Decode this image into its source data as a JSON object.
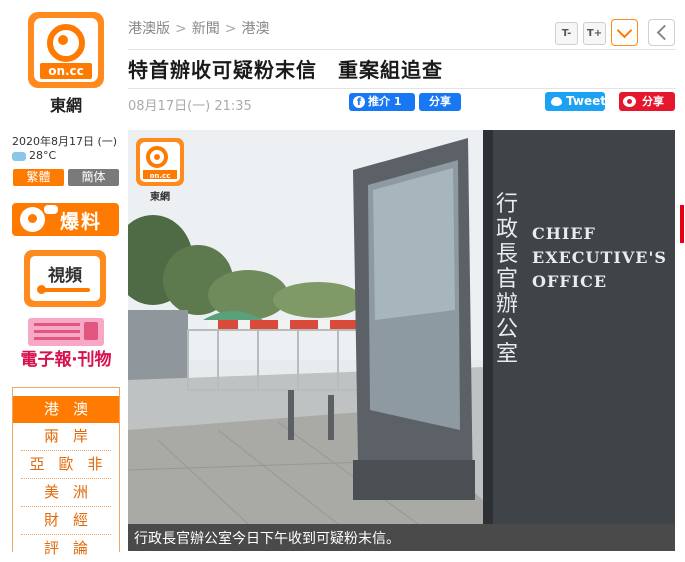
{
  "brand": {
    "logo_text": "on.cc",
    "name": "東網"
  },
  "sidebar": {
    "date": "2020年8月17日 (一)",
    "temperature": "28°C",
    "lang_traditional": "繁體",
    "lang_simplified": "簡体",
    "baoliao": "爆料",
    "video": "視頻",
    "epaper": "電子報‧刊物",
    "nav": [
      {
        "label": "港澳",
        "active": true
      },
      {
        "label": "兩岸",
        "active": false
      },
      {
        "label": "亞歐非",
        "active": false
      },
      {
        "label": "美洲",
        "active": false
      },
      {
        "label": "財經",
        "active": false
      },
      {
        "label": "評論",
        "active": false
      }
    ]
  },
  "header": {
    "breadcrumb": [
      "港澳版",
      "新聞",
      "港澳"
    ],
    "font_decrease": "T-",
    "font_increase": "T+"
  },
  "article": {
    "title": "特首辦收可疑粉末信　重案組追查",
    "datetime": "08月17日(一) 21:35",
    "fb_like": "推介 1",
    "fb_share": "分享",
    "tweet": "Tweet",
    "weibo_share": "分享",
    "photo": {
      "watermark_logo": "on.cc",
      "watermark_name": "東網",
      "sign_chinese": "行政長官辦公室",
      "sign_english_lines": [
        "CHIEF",
        "EXECUTIVE'S",
        "OFFICE"
      ]
    },
    "caption": "行政長官辦公室今日下午收到可疑粉末信。"
  }
}
